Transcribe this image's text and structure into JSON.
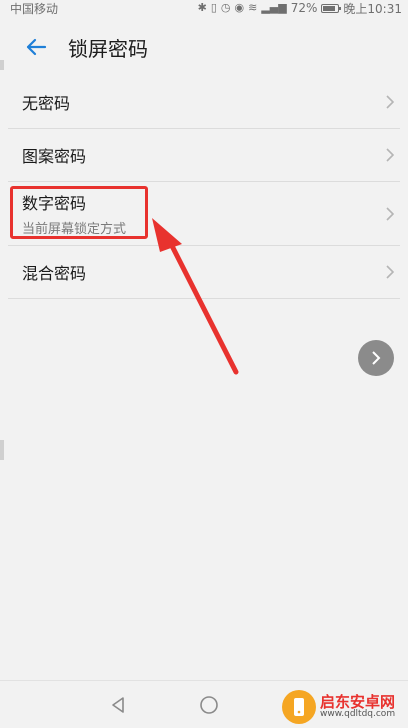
{
  "status_bar": {
    "carrier": "中国移动",
    "battery": "72%",
    "time": "晚上10:31"
  },
  "header": {
    "title": "锁屏密码"
  },
  "options": [
    {
      "label": "无密码",
      "subtitle": ""
    },
    {
      "label": "图案密码",
      "subtitle": ""
    },
    {
      "label": "数字密码",
      "subtitle": "当前屏幕锁定方式"
    },
    {
      "label": "混合密码",
      "subtitle": ""
    }
  ],
  "watermark": {
    "name": "启东安卓网",
    "url": "www.qdltdq.com"
  },
  "icons": {
    "back": "back-arrow-icon",
    "chevron": "chevron-right-icon",
    "fab": "chevron-right-icon",
    "nav_back": "triangle-back-icon",
    "nav_home": "circle-home-icon"
  },
  "colors": {
    "accent": "#1f7fd8",
    "annotation": "#e8322e",
    "background": "#f2f2f2"
  }
}
